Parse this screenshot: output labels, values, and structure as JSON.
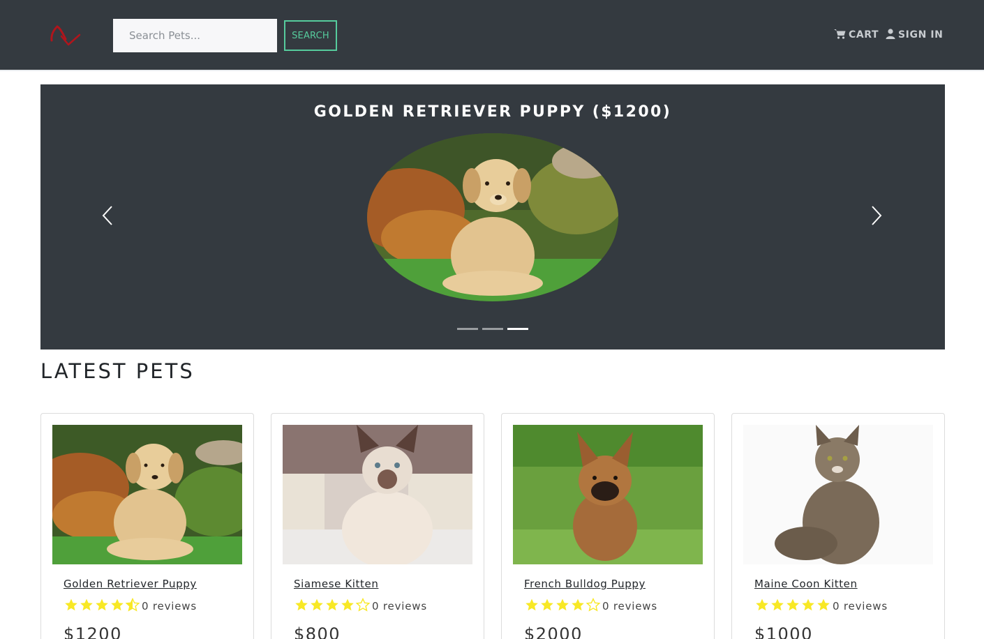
{
  "navbar": {
    "logo_icon": "pet-logo-icon",
    "search_placeholder": "Search Pets...",
    "search_button": "SEARCH",
    "cart_label": "CART",
    "cart_icon": "cart-icon",
    "signin_label": "SIGN IN",
    "signin_icon": "user-icon"
  },
  "carousel": {
    "caption": "GOLDEN RETRIEVER PUPPY ($1200)",
    "indicators": 3,
    "active_index": 2
  },
  "section": {
    "title": "LATEST PETS"
  },
  "products": [
    {
      "name": "Golden Retriever Puppy",
      "rating": 4.5,
      "reviews": "0 reviews",
      "price": "$1200"
    },
    {
      "name": "Siamese Kitten",
      "rating": 4,
      "reviews": "0 reviews",
      "price": "$800"
    },
    {
      "name": "French Bulldog Puppy",
      "rating": 4,
      "reviews": "0 reviews",
      "price": "$2000"
    },
    {
      "name": "Maine Coon Kitten",
      "rating": 5,
      "reviews": "0 reviews",
      "price": "$1000"
    }
  ],
  "colors": {
    "navbar_bg": "#343a40",
    "accent_green": "#56cc9d",
    "star_yellow": "#f8e825",
    "logo_red": "#b0151c"
  }
}
